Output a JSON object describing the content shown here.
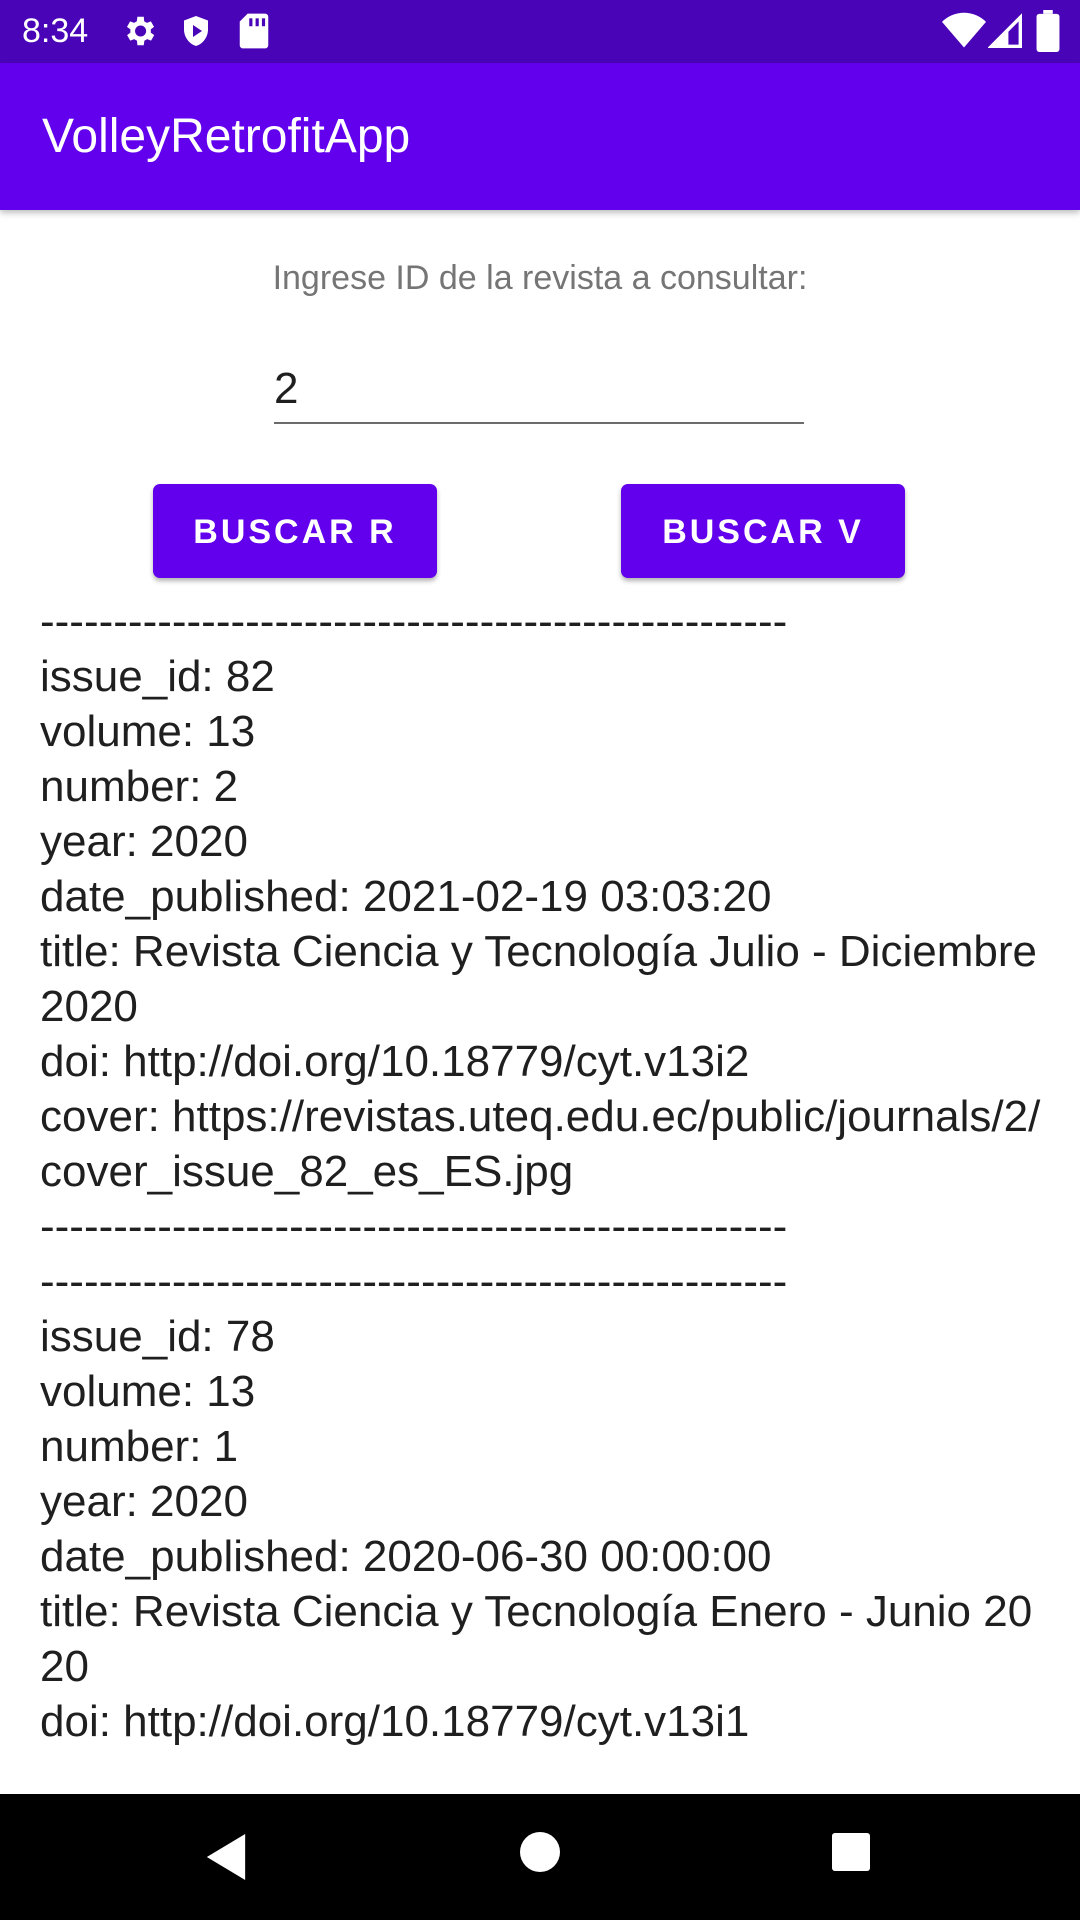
{
  "status_bar": {
    "time": "8:34",
    "left_icons": [
      "gear-icon",
      "shield-play-icon",
      "sd-card-icon"
    ],
    "right_icons": [
      "wifi-icon",
      "signal-icon",
      "battery-icon"
    ]
  },
  "app_bar": {
    "title": "VolleyRetrofitApp"
  },
  "form": {
    "prompt": "Ingrese ID de la revista a consultar:",
    "id_value": "2",
    "buttons": {
      "retrofit": "BUSCAR R",
      "volley": "BUSCAR V"
    }
  },
  "results": {
    "lines": [
      "---------------------------------------------------",
      "issue_id: 82",
      "volume: 13",
      "number: 2",
      "year: 2020",
      "date_published: 2021-02-19 03:03:20",
      "title: Revista Ciencia y Tecnología Julio - Diciembre 2020",
      "doi: http://doi.org/10.18779/cyt.v13i2",
      "cover: https://revistas.uteq.edu.ec/public/journals/2/cover_issue_82_es_ES.jpg",
      "---------------------------------------------------",
      "---------------------------------------------------",
      "issue_id: 78",
      "volume: 13",
      "number: 1",
      "year: 2020",
      "date_published: 2020-06-30 00:00:00",
      "title: Revista Ciencia y Tecnología Enero - Junio 2020",
      "doi: http://doi.org/10.18779/cyt.v13i1"
    ]
  },
  "nav_bar": {
    "buttons": [
      "back-icon",
      "home-icon",
      "recents-icon"
    ]
  },
  "colors": {
    "primary": "#6200ee",
    "primary_dark": "#4a04b8",
    "nav": "#000000"
  }
}
